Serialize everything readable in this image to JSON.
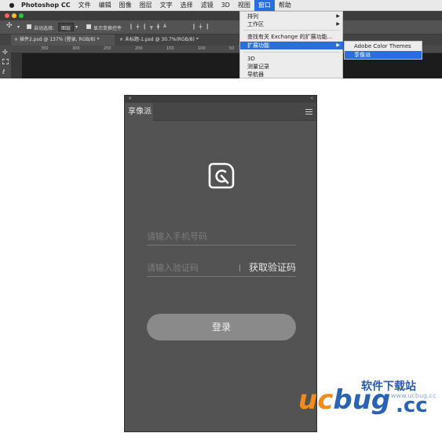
{
  "menubar": {
    "app": "Photoshop CC",
    "items": [
      "文件",
      "编辑",
      "图像",
      "图层",
      "文字",
      "选择",
      "滤镜",
      "3D",
      "视图",
      "窗口",
      "帮助"
    ],
    "active": "窗口"
  },
  "options": {
    "auto_select": "自动选择:",
    "layer_value": "图层",
    "show_transform": "显示变换控件"
  },
  "doc_tabs": [
    "插件2.psd @ 137% (登录, RGB/8) *",
    "未标题-1.psd @ 30.7%(RGB/8) *"
  ],
  "ruler": [
    "350",
    "300",
    "250",
    "200",
    "150",
    "100",
    "50",
    "0",
    "50",
    "100",
    "150"
  ],
  "window_menu": {
    "items": [
      {
        "label": "排列",
        "arrow": "▶"
      },
      {
        "label": "工作区",
        "arrow": "▶"
      },
      {
        "label": "查找有关 Exchange 的扩展功能...",
        "arrow": ""
      },
      {
        "label": "扩展功能",
        "arrow": "▶"
      },
      {
        "label": "3D",
        "arrow": ""
      },
      {
        "label": "测量记录",
        "arrow": ""
      },
      {
        "label": "导航器",
        "arrow": ""
      }
    ],
    "submenu": [
      "Adobe Color Themes",
      "享像派"
    ]
  },
  "panel": {
    "tab": "享像派",
    "close": "×",
    "collapse": "«",
    "phone_placeholder": "请输入手机号码",
    "code_placeholder": "请输入验证码",
    "get_code": "获取验证码",
    "login": "登录"
  },
  "watermark": {
    "title": "软件下载站",
    "site": "www.ucbug.cc",
    "logo_uc": "uc",
    "logo_bug": "bug",
    "logo_cc": ".cc"
  },
  "colors": {
    "accent": "#2a6ede",
    "panel_bg": "#535353",
    "login_btn": "#8a8a8a"
  }
}
